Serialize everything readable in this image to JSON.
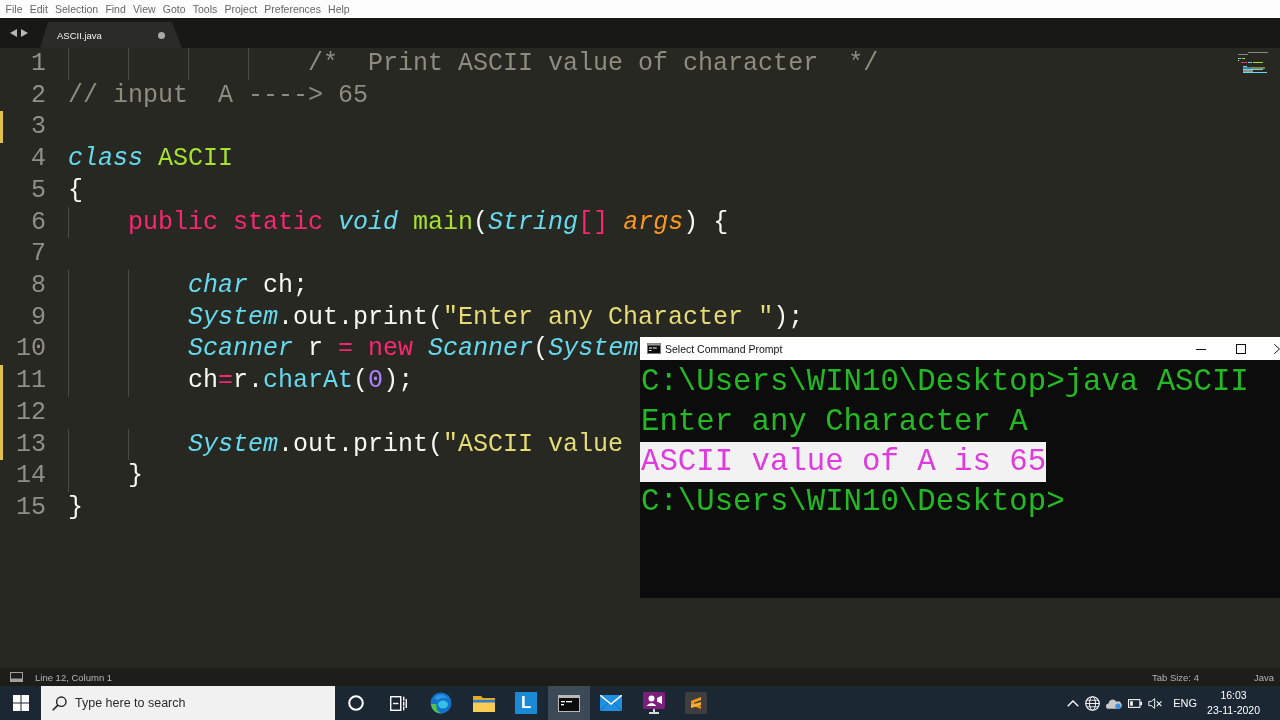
{
  "menu_bar": [
    "File",
    "Edit",
    "Selection",
    "Find",
    "View",
    "Goto",
    "Tools",
    "Project",
    "Preferences",
    "Help"
  ],
  "editor_tabs": [
    {
      "label": "ASCII.java",
      "selected": true,
      "modified": true
    }
  ],
  "editor": {
    "lines": [
      {
        "number": "1",
        "modified": false,
        "tokens": [
          {
            "kind": "comment",
            "text": "                /*  Print ASCII value of character  */"
          }
        ]
      },
      {
        "number": "2",
        "modified": false,
        "tokens": [
          {
            "kind": "comment",
            "text": "// input  A ----> 65"
          }
        ]
      },
      {
        "number": "3",
        "modified": true
      },
      {
        "number": "4",
        "modified": false,
        "tokens": [
          {
            "kind": "storage",
            "text": "class"
          },
          {
            "kind": "entity",
            "text": " ASCII"
          }
        ]
      },
      {
        "number": "5",
        "modified": false,
        "tokens": [
          {
            "kind": "plain",
            "text": "{"
          }
        ]
      },
      {
        "number": "6",
        "modified": false,
        "tokens": [
          {
            "kind": "keyword",
            "text": "    public"
          },
          {
            "kind": "keyword",
            "text": " static"
          },
          {
            "kind": "storage",
            "text": " void"
          },
          {
            "kind": "entity",
            "text": " main"
          },
          {
            "kind": "plain",
            "text": "("
          },
          {
            "kind": "storage",
            "text": "String"
          },
          {
            "kind": "keyword",
            "text": "[]"
          },
          {
            "kind": "parameter",
            "text": " args"
          },
          {
            "kind": "plain",
            "text": ") {"
          }
        ]
      },
      {
        "number": "7",
        "modified": false
      },
      {
        "number": "8",
        "modified": false,
        "tokens": [
          {
            "kind": "storage",
            "text": "        char"
          },
          {
            "kind": "plain",
            "text": " ch;"
          }
        ]
      },
      {
        "number": "9",
        "modified": false,
        "tokens": [
          {
            "kind": "storage",
            "text": "        System"
          },
          {
            "kind": "plain",
            "text": ".out.print("
          },
          {
            "kind": "string",
            "text": "\"Enter any Character \""
          },
          {
            "kind": "plain",
            "text": ");"
          }
        ]
      },
      {
        "number": "10",
        "modified": false,
        "tokens": [
          {
            "kind": "storage",
            "text": "        Scanner"
          },
          {
            "kind": "plain",
            "text": " r "
          },
          {
            "kind": "keyword",
            "text": "="
          },
          {
            "kind": "keyword",
            "text": " new"
          },
          {
            "kind": "storage",
            "text": " Scanner"
          },
          {
            "kind": "plain",
            "text": "("
          },
          {
            "kind": "storage",
            "text": "System"
          }
        ]
      },
      {
        "number": "11",
        "modified": true,
        "tokens": [
          {
            "kind": "plain",
            "text": "        ch"
          },
          {
            "kind": "keyword",
            "text": "="
          },
          {
            "kind": "plain",
            "text": "r."
          },
          {
            "kind": "call",
            "text": "charAt"
          },
          {
            "kind": "plain",
            "text": "("
          },
          {
            "kind": "number",
            "text": "0"
          },
          {
            "kind": "plain",
            "text": ");"
          }
        ]
      },
      {
        "number": "12",
        "modified": true
      },
      {
        "number": "13",
        "modified": true,
        "tokens": [
          {
            "kind": "storage",
            "text": "        System"
          },
          {
            "kind": "plain",
            "text": ".out.print("
          },
          {
            "kind": "string",
            "text": "\"ASCII value"
          }
        ]
      },
      {
        "number": "14",
        "modified": false,
        "tokens": [
          {
            "kind": "plain",
            "text": "    }"
          }
        ]
      },
      {
        "number": "15",
        "modified": false,
        "tokens": [
          {
            "kind": "plain",
            "text": "}"
          }
        ]
      }
    ]
  },
  "command_prompt": {
    "title": "Select Command Prompt",
    "lines": [
      {
        "text": "C:\\Users\\WIN10\\Desktop>java ASCII",
        "selected": false
      },
      {
        "text": "Enter any Character A",
        "selected": false
      },
      {
        "text": "ASCII value of A is 65",
        "selected": true
      },
      {
        "text": "C:\\Users\\WIN10\\Desktop>",
        "selected": false
      }
    ]
  },
  "status_bar": {
    "position": "Line 12, Column 1",
    "tab_size": "Tab Size: 4",
    "syntax": "Java"
  },
  "taskbar": {
    "search": {
      "placeholder": "Type here to search"
    },
    "apps": [
      {
        "kind": "browser",
        "selected": false
      },
      {
        "kind": "folder",
        "selected": false
      },
      {
        "kind": "letter",
        "label": "L",
        "selected": false
      },
      {
        "kind": "terminal",
        "selected": true
      },
      {
        "kind": "mail",
        "selected": false
      },
      {
        "kind": "video",
        "selected": false
      },
      {
        "kind": "editor",
        "selected": false
      }
    ],
    "language": "ENG",
    "time": "16:03",
    "date": "23-11-2020"
  }
}
